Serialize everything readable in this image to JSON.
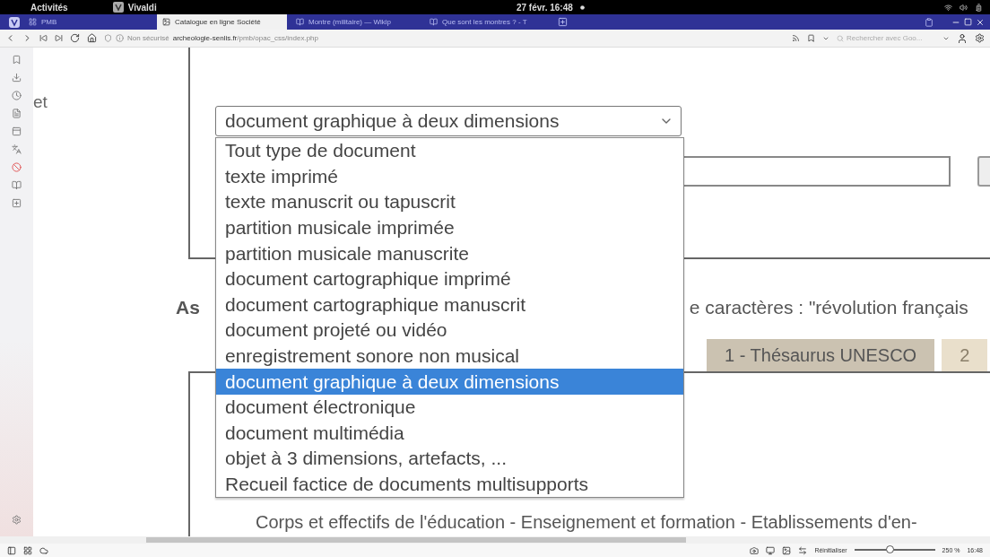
{
  "top_bar": {
    "activities": "Activités",
    "app": "Vivaldi",
    "clock": "27 févr. 16:48"
  },
  "tabs": [
    {
      "label": "PMB",
      "selected": false
    },
    {
      "label": "Catalogue en ligne Société",
      "selected": true
    },
    {
      "label": "Montre (militaire) — Wikip",
      "selected": false
    },
    {
      "label": "Que sont les montres ? - T",
      "selected": false
    }
  ],
  "address_bar": {
    "security": "Non sécurisé",
    "domain": "archeologie-senlis.fr",
    "path": "/pmb/opac_css/index.php",
    "search_placeholder": "Rechercher avec Goo..."
  },
  "page": {
    "label_fragment": "et",
    "select": {
      "value": "document graphique à deux dimensions",
      "expanded": true,
      "options": [
        {
          "label": "Tout type de document",
          "selected": false
        },
        {
          "label": "texte imprimé",
          "selected": false
        },
        {
          "label": "texte manuscrit ou tapuscrit",
          "selected": false
        },
        {
          "label": "partition musicale imprimée",
          "selected": false
        },
        {
          "label": "partition musicale manuscrite",
          "selected": false
        },
        {
          "label": "document cartographique imprimé",
          "selected": false
        },
        {
          "label": "document cartographique manuscrit",
          "selected": false
        },
        {
          "label": "document projeté ou vidéo",
          "selected": false
        },
        {
          "label": "enregistrement sonore non musical",
          "selected": false
        },
        {
          "label": "document graphique à deux dimensions",
          "selected": true
        },
        {
          "label": "document électronique",
          "selected": false
        },
        {
          "label": "document multimédia",
          "selected": false
        },
        {
          "label": "objet à 3 dimensions, artefacts, ...",
          "selected": false
        },
        {
          "label": "Recueil factice de documents multisupports",
          "selected": false
        }
      ]
    },
    "hint_start": "As",
    "hint_end": "e caractères : \"révolution français",
    "thesaurus_tabs": [
      {
        "label": "1 - Thésaurus UNESCO",
        "selected": true
      },
      {
        "label": "2",
        "selected": false
      }
    ],
    "category_line": "Corps et effectifs de l'éducation - Enseignement et formation - Etablissements d'en-"
  },
  "status_bar": {
    "reset": "Réinitialiser",
    "zoom_slider": {
      "level": 0.45
    },
    "zoom": "250 %",
    "clock": "16:48"
  }
}
